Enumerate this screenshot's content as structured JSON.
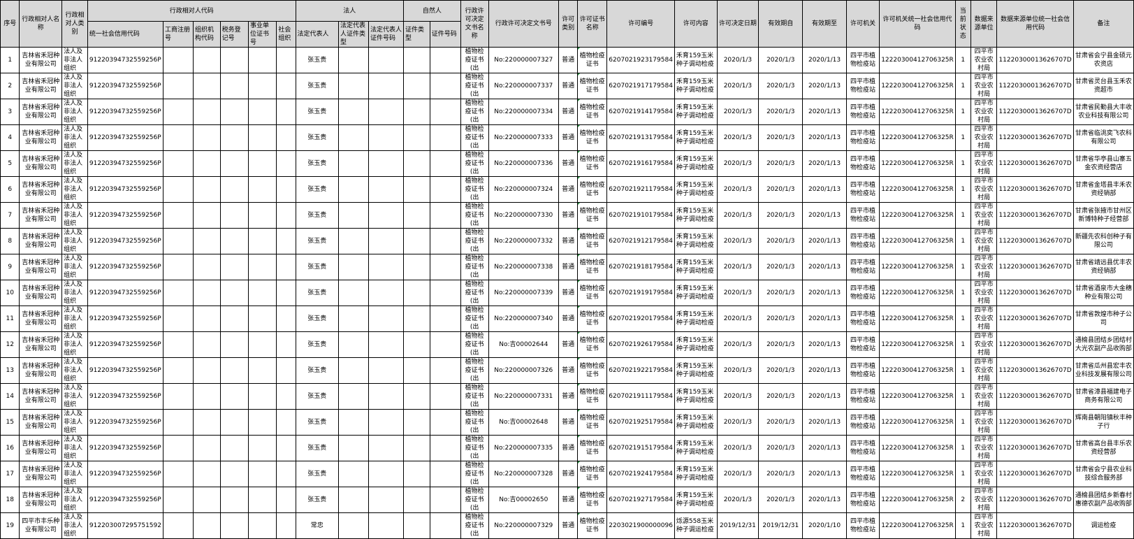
{
  "headers": {
    "seq": "序号",
    "name": "行政相对人名称",
    "category": "行政相对人类别",
    "code_group": "行政相对人代码",
    "uscc": "统一社会信用代码",
    "biz_reg": "工商注册号",
    "org_code": "组织机构代码",
    "tax_reg": "税务登记号",
    "inst_cert": "事业单位证书号",
    "soc_org": "社会组织",
    "legal_group": "法人",
    "legal_rep": "法定代表人",
    "legal_id_type": "法定代表人证件类型",
    "legal_id_no": "法定代表人证件号码",
    "natural_group": "自然人",
    "cert_type": "证件类型",
    "cert_no": "证件号码",
    "decision_doc_name": "行政许可决定文书名称",
    "decision_doc_no": "行政许可决定文书号",
    "permit_type": "许可类别",
    "cert_name": "许可证书名称",
    "permit_no": "许可编号",
    "permit_content": "许可内容",
    "decision_date": "许可决定日期",
    "valid_from": "有效期自",
    "valid_to": "有效期至",
    "permit_org": "许可机关",
    "org_uscc": "许可机关统一社会信用代码",
    "status": "当前状态",
    "source_unit": "数据来源单位",
    "source_uscc": "数据来源单位统一社会信用代码",
    "remark": "备注"
  },
  "rows": [
    {
      "seq": "1",
      "name": "吉林省禾冠种业有限公司",
      "category": "法人及非法人组织",
      "uscc": "91220394732559256P",
      "legal_rep": "张玉贵",
      "doc_name": "植物检疫证书(出",
      "doc_no": "No:220000007327",
      "ptype": "普通",
      "cert_name": "植物检疫证书",
      "permit_no": "6207021923179584",
      "content": "禾育159玉米种子调动检疫",
      "date": "2020/1/3",
      "from": "2020/1/3",
      "to": "2020/1/13",
      "org": "四平市植物检疫站",
      "org_uscc": "12220300412706325R",
      "status": "1",
      "src": "四平市农业农村局",
      "src_uscc": "11220300013626707D",
      "remark": "甘肃省会宁县金硕元农资店"
    },
    {
      "seq": "2",
      "name": "吉林省禾冠种业有限公司",
      "category": "法人及非法人组织",
      "uscc": "91220394732559256P",
      "legal_rep": "张玉贵",
      "doc_name": "植物检疫证书(出",
      "doc_no": "No:220000007337",
      "ptype": "普通",
      "cert_name": "植物检疫证书",
      "permit_no": "6207021917179584",
      "content": "禾育159玉米种子调动检疫",
      "date": "2020/1/3",
      "from": "2020/1/3",
      "to": "2020/1/13",
      "org": "四平市植物检疫站",
      "org_uscc": "12220300412706325R",
      "status": "1",
      "src": "四平市农业农村局",
      "src_uscc": "11220300013626707D",
      "remark": "甘肃省灵台县玉禾农资超市"
    },
    {
      "seq": "3",
      "name": "吉林省禾冠种业有限公司",
      "category": "法人及非法人组织",
      "uscc": "91220394732559256P",
      "legal_rep": "张玉贵",
      "doc_name": "植物检疫证书(出",
      "doc_no": "No:220000007334",
      "ptype": "普通",
      "cert_name": "植物检疫证书",
      "permit_no": "6207021914179584",
      "content": "禾育159玉米种子调动检疫",
      "date": "2020/1/3",
      "from": "2020/1/3",
      "to": "2020/1/13",
      "org": "四平市植物检疫站",
      "org_uscc": "12220300412706325R",
      "status": "1",
      "src": "四平市农业农村局",
      "src_uscc": "11220300013626707D",
      "remark": "甘肃省民勤县大丰收农业科技有限公司"
    },
    {
      "seq": "4",
      "name": "吉林省禾冠种业有限公司",
      "category": "法人及非法人组织",
      "uscc": "91220394732559256P",
      "legal_rep": "张玉贵",
      "doc_name": "植物检疫证书(出",
      "doc_no": "No:220000007333",
      "ptype": "普通",
      "cert_name": "植物检疫证书",
      "permit_no": "6207021913179584",
      "content": "禾育159玉米种子调动检疫",
      "date": "2020/1/3",
      "from": "2020/1/3",
      "to": "2020/1/13",
      "org": "四平市植物检疫站",
      "org_uscc": "12220300412706325R",
      "status": "1",
      "src": "四平市农业农村局",
      "src_uscc": "11220300013626707D",
      "remark": "甘肃省临洮奕飞农科有限公司"
    },
    {
      "seq": "5",
      "name": "吉林省禾冠种业有限公司",
      "category": "法人及非法人组织",
      "uscc": "91220394732559256P",
      "legal_rep": "张玉贵",
      "doc_name": "植物检疫证书(出",
      "doc_no": "No:220000007336",
      "ptype": "普通",
      "cert_name": "植物检疫证书",
      "permit_no": "6207021916179584",
      "content": "禾育159玉米种子调动检疫",
      "date": "2020/1/3",
      "from": "2020/1/3",
      "to": "2020/1/13",
      "org": "四平市植物检疫站",
      "org_uscc": "12220300412706325R",
      "status": "1",
      "src": "四平市农业农村局",
      "src_uscc": "11220300013626707D",
      "remark": "甘肃省华亭县山寨五金农资经营店"
    },
    {
      "seq": "6",
      "name": "吉林省禾冠种业有限公司",
      "category": "法人及非法人组织",
      "uscc": "91220394732559256P",
      "legal_rep": "张玉贵",
      "doc_name": "植物检疫证书(出",
      "doc_no": "No:220000007324",
      "ptype": "普通",
      "cert_name": "植物检疫证书",
      "permit_no": "6207021921179584",
      "content": "禾育159玉米种子调动检疫",
      "date": "2020/1/3",
      "from": "2020/1/3",
      "to": "2020/1/13",
      "org": "四平市植物检疫站",
      "org_uscc": "12220300412706325R",
      "status": "1",
      "src": "四平市农业农村局",
      "src_uscc": "11220300013626707D",
      "remark": "甘肃省金塔县丰禾农资经销部"
    },
    {
      "seq": "7",
      "name": "吉林省禾冠种业有限公司",
      "category": "法人及非法人组织",
      "uscc": "91220394732559256P",
      "legal_rep": "张玉贵",
      "doc_name": "植物检疫证书(出",
      "doc_no": "No:220000007330",
      "ptype": "普通",
      "cert_name": "植物检疫证书",
      "permit_no": "6207021910179584",
      "content": "禾育159玉米种子调动检疫",
      "date": "2020/1/3",
      "from": "2020/1/3",
      "to": "2020/1/13",
      "org": "四平市植物检疫站",
      "org_uscc": "12220300412706325R",
      "status": "1",
      "src": "四平市农业农村局",
      "src_uscc": "11220300013626707D",
      "remark": "甘肃省张掖市甘州区新博特种子经营部"
    },
    {
      "seq": "8",
      "name": "吉林省禾冠种业有限公司",
      "category": "法人及非法人组织",
      "uscc": "91220394732559256P",
      "legal_rep": "张玉贵",
      "doc_name": "植物检疫证书(出",
      "doc_no": "No:220000007332",
      "ptype": "普通",
      "cert_name": "植物检疫证书",
      "permit_no": "6207021912179584",
      "content": "禾育159玉米种子调动检疫",
      "date": "2020/1/3",
      "from": "2020/1/3",
      "to": "2020/1/13",
      "org": "四平市植物检疫站",
      "org_uscc": "12220300412706325R",
      "status": "1",
      "src": "四平市农业农村局",
      "src_uscc": "11220300013626707D",
      "remark": "新疆先农科创种子有限公司"
    },
    {
      "seq": "9",
      "name": "吉林省禾冠种业有限公司",
      "category": "法人及非法人组织",
      "uscc": "91220394732559256P",
      "legal_rep": "张玉贵",
      "doc_name": "植物检疫证书(出",
      "doc_no": "No:220000007338",
      "ptype": "普通",
      "cert_name": "植物检疫证书",
      "permit_no": "6207021918179584",
      "content": "禾育159玉米种子调动检疫",
      "date": "2020/1/3",
      "from": "2020/1/3",
      "to": "2020/1/13",
      "org": "四平市植物检疫站",
      "org_uscc": "12220300412706325R",
      "status": "1",
      "src": "四平市农业农村局",
      "src_uscc": "11220300013626707D",
      "remark": "甘肃省靖远县优丰农资经销部"
    },
    {
      "seq": "10",
      "name": "吉林省禾冠种业有限公司",
      "category": "法人及非法人组织",
      "uscc": "91220394732559256P",
      "legal_rep": "张玉贵",
      "doc_name": "植物检疫证书(出",
      "doc_no": "No:220000007339",
      "ptype": "普通",
      "cert_name": "植物检疫证书",
      "permit_no": "6207021919179584",
      "content": "禾育159玉米种子调动检疫",
      "date": "2020/1/3",
      "from": "2020/1/3",
      "to": "2020/1/13",
      "org": "四平市植物检疫站",
      "org_uscc": "12220300412706325R",
      "status": "1",
      "src": "四平市农业农村局",
      "src_uscc": "11220300013626707D",
      "remark": "甘肃省酒泉市大金穗种业有限公司"
    },
    {
      "seq": "11",
      "name": "吉林省禾冠种业有限公司",
      "category": "法人及非法人组织",
      "uscc": "91220394732559256P",
      "legal_rep": "张玉贵",
      "doc_name": "植物检疫证书(出",
      "doc_no": "No:220000007340",
      "ptype": "普通",
      "cert_name": "植物检疫证书",
      "permit_no": "6207021920179584",
      "content": "禾育159玉米种子调动检疫",
      "date": "2020/1/3",
      "from": "2020/1/3",
      "to": "2020/1/13",
      "org": "四平市植物检疫站",
      "org_uscc": "12220300412706325R",
      "status": "1",
      "src": "四平市农业农村局",
      "src_uscc": "11220300013626707D",
      "remark": "甘肃省敦煌市种子公司"
    },
    {
      "seq": "12",
      "name": "吉林省禾冠种业有限公司",
      "category": "法人及非法人组织",
      "uscc": "91220394732559256P",
      "legal_rep": "张玉贵",
      "doc_name": "植物检疫证书(出",
      "doc_no": "No:吉00002644",
      "ptype": "普通",
      "cert_name": "植物检疫证书",
      "permit_no": "6207021926179584",
      "content": "禾育159玉米种子调动检疫",
      "date": "2020/1/3",
      "from": "2020/1/3",
      "to": "2020/1/13",
      "org": "四平市植物检疫站",
      "org_uscc": "12220300412706325R",
      "status": "1",
      "src": "四平市农业农村局",
      "src_uscc": "11220300013626707D",
      "remark": "通榆县团结乡团结村大光农副产品收购部"
    },
    {
      "seq": "13",
      "name": "吉林省禾冠种业有限公司",
      "category": "法人及非法人组织",
      "uscc": "91220394732559256P",
      "legal_rep": "张玉贵",
      "doc_name": "植物检疫证书(出",
      "doc_no": "No:220000007326",
      "ptype": "普通",
      "cert_name": "植物检疫证书",
      "permit_no": "6207021922179584",
      "content": "禾育159玉米种子调动检疫",
      "date": "2020/1/3",
      "from": "2020/1/3",
      "to": "2020/1/13",
      "org": "四平市植物检疫站",
      "org_uscc": "12220300412706325R",
      "status": "1",
      "src": "四平市农业农村局",
      "src_uscc": "11220300013626707D",
      "remark": "甘肃省瓜州县宏丰农业科技发展有限公司"
    },
    {
      "seq": "14",
      "name": "吉林省禾冠种业有限公司",
      "category": "法人及非法人组织",
      "uscc": "91220394732559256P",
      "legal_rep": "张玉贵",
      "doc_name": "植物检疫证书(出",
      "doc_no": "No:220000007331",
      "ptype": "普通",
      "cert_name": "植物检疫证书",
      "permit_no": "6207021911179584",
      "content": "禾育159玉米种子调动检疫",
      "date": "2020/1/3",
      "from": "2020/1/3",
      "to": "2020/1/13",
      "org": "四平市植物检疫站",
      "org_uscc": "12220300412706325R",
      "status": "1",
      "src": "四平市农业农村局",
      "src_uscc": "11220300013626707D",
      "remark": "甘肃省漳县福建电子商务有限公司"
    },
    {
      "seq": "15",
      "name": "吉林省禾冠种业有限公司",
      "category": "法人及非法人组织",
      "uscc": "91220394732559256P",
      "legal_rep": "张玉贵",
      "doc_name": "植物检疫证书(出",
      "doc_no": "No:吉00002648",
      "ptype": "普通",
      "cert_name": "植物检疫证书",
      "permit_no": "6207021925179584",
      "content": "禾育159玉米种子调动检疫",
      "date": "2020/1/3",
      "from": "2020/1/3",
      "to": "2020/1/13",
      "org": "四平市植物检疫站",
      "org_uscc": "12220300412706325R",
      "status": "1",
      "src": "四平市农业农村局",
      "src_uscc": "11220300013626707D",
      "remark": "辉南县朝阳镇秋丰种子行"
    },
    {
      "seq": "16",
      "name": "吉林省禾冠种业有限公司",
      "category": "法人及非法人组织",
      "uscc": "91220394732559256P",
      "legal_rep": "张玉贵",
      "doc_name": "植物检疫证书(出",
      "doc_no": "No:220000007335",
      "ptype": "普通",
      "cert_name": "植物检疫证书",
      "permit_no": "6207021915179584",
      "content": "禾育159玉米种子调动检疫",
      "date": "2020/1/3",
      "from": "2020/1/3",
      "to": "2020/1/13",
      "org": "四平市植物检疫站",
      "org_uscc": "12220300412706325R",
      "status": "1",
      "src": "四平市农业农村局",
      "src_uscc": "11220300013626707D",
      "remark": "甘肃省高台县丰乐农资经营部"
    },
    {
      "seq": "17",
      "name": "吉林省禾冠种业有限公司",
      "category": "法人及非法人组织",
      "uscc": "91220394732559256P",
      "legal_rep": "张玉贵",
      "doc_name": "植物检疫证书(出",
      "doc_no": "No:220000007328",
      "ptype": "普通",
      "cert_name": "植物检疫证书",
      "permit_no": "6207021924179584",
      "content": "禾育159玉米种子调动检疫",
      "date": "2020/1/3",
      "from": "2020/1/3",
      "to": "2020/1/13",
      "org": "四平市植物检疫站",
      "org_uscc": "12220300412706325R",
      "status": "1",
      "src": "四平市农业农村局",
      "src_uscc": "11220300013626707D",
      "remark": "甘肃省会宁县农业科技综合服务部"
    },
    {
      "seq": "18",
      "name": "吉林省禾冠种业有限公司",
      "category": "法人及非法人组织",
      "uscc": "91220394732559256P",
      "legal_rep": "张玉贵",
      "doc_name": "植物检疫证书(出",
      "doc_no": "No:吉00002650",
      "ptype": "普通",
      "cert_name": "植物检疫证书",
      "permit_no": "6207021927179584",
      "content": "禾育159玉米种子调动检疫",
      "date": "2020/1/3",
      "from": "2020/1/3",
      "to": "2020/1/13",
      "org": "四平市植物检疫站",
      "org_uscc": "12220300412706325R",
      "status": "2",
      "src": "四平市农业农村局",
      "src_uscc": "11220300013626707D",
      "remark": "通榆县团结乡新春村惠德农副产品收购部"
    },
    {
      "seq": "19",
      "name": "四平市丰乐种业有限公司",
      "category": "法人及非法人组织",
      "uscc": "912203007295751592",
      "legal_rep": "常忠",
      "doc_name": "植物检疫证书(出",
      "doc_no": "No:220000007329",
      "ptype": "普通",
      "cert_name": "植物检疫证书",
      "permit_no": "2203021900000096",
      "content": "烁源558玉米种子调运检疫",
      "date": "2019/12/31",
      "from": "2019/12/31",
      "to": "2020/1/10",
      "org": "四平市植物检疫站",
      "org_uscc": "12220300412706325R",
      "status": "1",
      "src": "四平市农业农村局",
      "src_uscc": "11220300013626707D",
      "remark": "调运检疫"
    }
  ]
}
